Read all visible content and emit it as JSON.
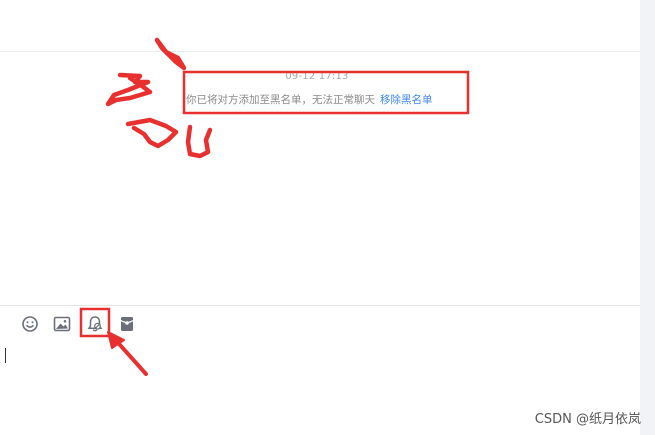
{
  "chat": {
    "timestamp": "09-12 17:13",
    "notice_text": "你已将对方添加至黑名单，无法正常聊天",
    "notice_link": "移除黑名单"
  },
  "toolbar": {
    "items": [
      {
        "icon": "emoji-icon"
      },
      {
        "icon": "image-icon"
      },
      {
        "icon": "bell-icon"
      },
      {
        "icon": "red-envelope-icon"
      }
    ]
  },
  "watermark": "CSDN @纸月依岚",
  "colors": {
    "annotation_red": "#e8312f",
    "link_blue": "#3f87f1",
    "icon_gray": "#6b6f7a"
  }
}
